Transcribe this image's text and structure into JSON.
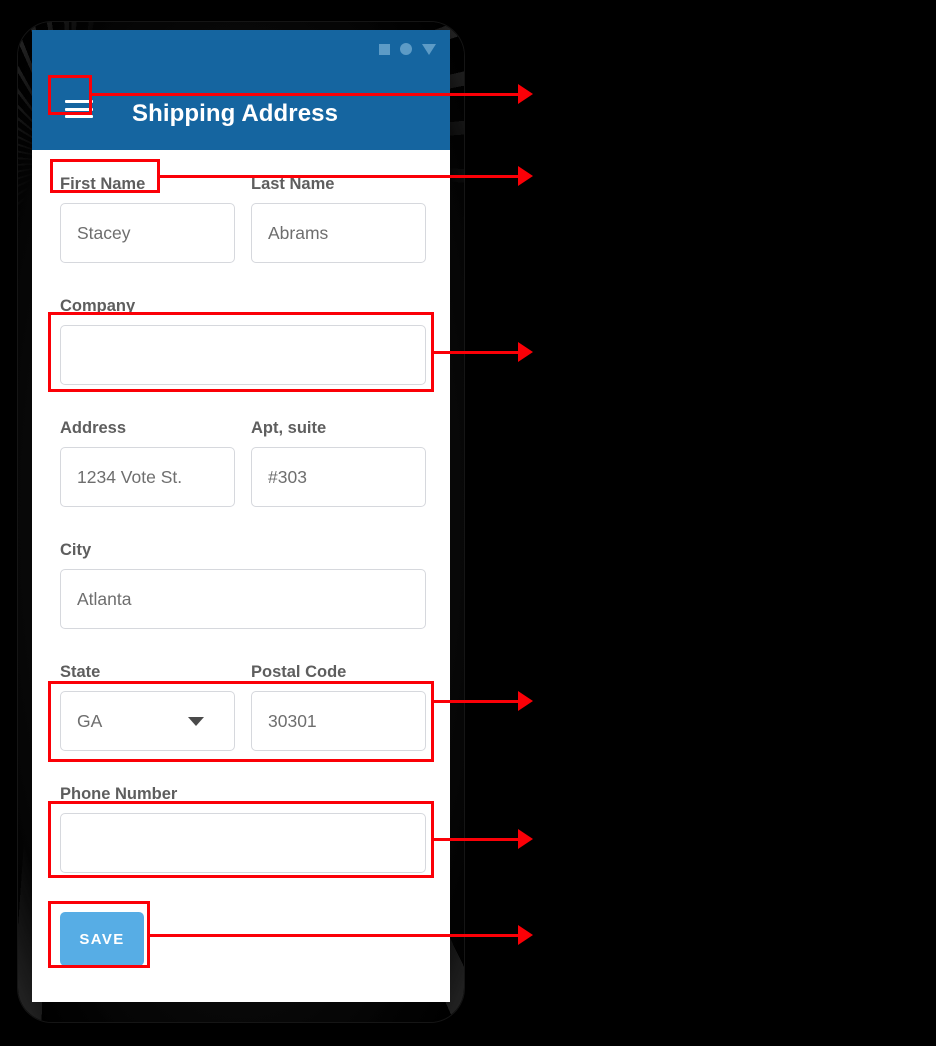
{
  "app": {
    "title": "Shipping Address",
    "menu_icon": "hamburger-menu-icon",
    "status_icons": [
      "square-icon",
      "circle-icon",
      "triangle-down-icon"
    ],
    "header_color": "#1565a0",
    "accent_color": "#57ade5",
    "annotation_color": "#fb0007"
  },
  "form": {
    "fields": [
      {
        "label": "First Name",
        "value": "Stacey",
        "type": "text",
        "width": "half"
      },
      {
        "label": "Last Name",
        "value": "Abrams",
        "type": "text",
        "width": "half"
      },
      {
        "label": "Company",
        "value": "",
        "type": "text",
        "width": "full"
      },
      {
        "label": "Address",
        "value": "1234 Vote St.",
        "type": "text",
        "width": "half"
      },
      {
        "label": "Apt, suite",
        "value": "#303",
        "type": "text",
        "width": "half"
      },
      {
        "label": "City",
        "value": "Atlanta",
        "type": "text",
        "width": "full"
      },
      {
        "label": "State",
        "value": "GA",
        "type": "select",
        "width": "half"
      },
      {
        "label": "Postal Code",
        "value": "30301",
        "type": "text",
        "width": "half"
      },
      {
        "label": "Phone Number",
        "value": "",
        "type": "text",
        "width": "full"
      }
    ],
    "save_label": "SAVE"
  },
  "annotations": [
    {
      "target": "hamburger-menu-button"
    },
    {
      "target": "first-name-label"
    },
    {
      "target": "company-input"
    },
    {
      "target": "state-postal-row"
    },
    {
      "target": "phone-number-input"
    },
    {
      "target": "save-button"
    }
  ]
}
